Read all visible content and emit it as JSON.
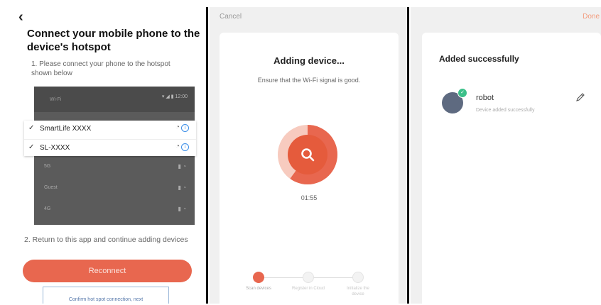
{
  "panel1": {
    "back_icon": "chevron-left-icon",
    "title": "Connect your mobile phone to the device's hotspot",
    "step1": "1. Please connect your phone to the hotspot shown below",
    "phone": {
      "wifi_label": "Wi-Fi",
      "status": "▾ ◢ ▮ 12:00",
      "networks": [
        "SmartLife XXXX",
        "SL-XXXX"
      ],
      "other_networks": [
        "5G",
        "Guest",
        "4G"
      ]
    },
    "step2": "2. Return to this app and continue adding devices",
    "reconnect_label": "Reconnect",
    "confirm_label": "Confirm hot spot connection, next"
  },
  "panel2": {
    "cancel_label": "Cancel",
    "title": "Adding device...",
    "subtitle": "Ensure that the Wi-Fi signal is good.",
    "timer": "01:55",
    "progress_fraction": 0.6,
    "steps": [
      "Scan devices",
      "Register in Cloud",
      "Initialize the device"
    ]
  },
  "panel3": {
    "done_label": "Done",
    "title": "Added successfully",
    "device_name": "robot",
    "device_status": "Device added successfully"
  },
  "colors": {
    "accent": "#e8674f",
    "success": "#3cc08a",
    "link": "#3b8ee8"
  }
}
